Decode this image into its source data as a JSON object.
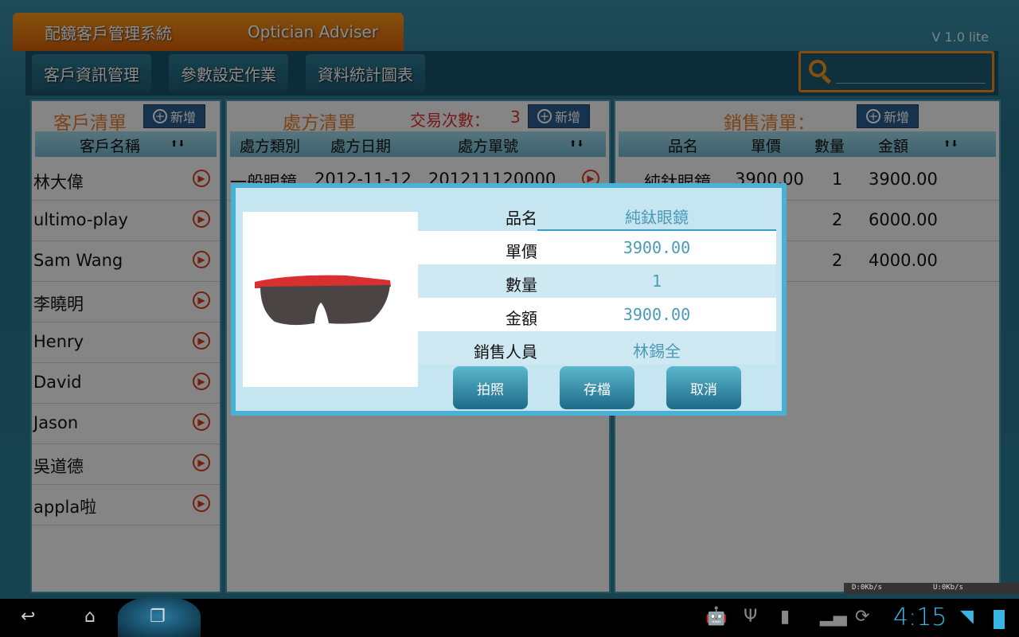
{
  "header": {
    "title_cn": "配鏡客戶管理系統",
    "title_en": "Optician Adviser",
    "version": "V 1.0 lite",
    "search_value": ""
  },
  "nav": [
    "客戶資訊管理",
    "參數設定作業",
    "資料統計圖表"
  ],
  "customers": {
    "title": "客戶清單",
    "add": "新增",
    "col": "客戶名稱",
    "sort": "⬆⬇",
    "rows": [
      "林大偉",
      "ultimo-play",
      "Sam Wang",
      "李曉明",
      "Henry",
      "David",
      "Jason",
      "吳道德",
      "appla啦"
    ]
  },
  "prescriptions": {
    "title": "處方清單",
    "count_label": "交易次數：",
    "count": "3",
    "add": "新增",
    "cols": [
      "處方類別",
      "處方日期",
      "處方單號"
    ],
    "sort": "⬆⬇",
    "rows": [
      {
        "type": "一般眼鏡",
        "date": "2012-11-12",
        "no": "201211120000"
      }
    ]
  },
  "sales": {
    "title": "銷售清單：",
    "add": "新增",
    "cols": [
      "品名",
      "單價",
      "數量",
      "金額"
    ],
    "sort": "⬆⬇",
    "rows": [
      {
        "name": "純鈦眼鏡",
        "price": "3900.00",
        "qty": "1",
        "amount": "3900.00"
      },
      {
        "name": "",
        "price": "00",
        "qty": "2",
        "amount": "6000.00"
      },
      {
        "name": "",
        "price": "00",
        "qty": "2",
        "amount": "4000.00"
      }
    ]
  },
  "dialog": {
    "fields": [
      {
        "label": "品名",
        "value": "純鈦眼鏡"
      },
      {
        "label": "單價",
        "value": "3900.00"
      },
      {
        "label": "數量",
        "value": "1"
      },
      {
        "label": "金額",
        "value": "3900.00"
      },
      {
        "label": "銷售人員",
        "value": "林錫全"
      }
    ],
    "buttons": [
      "拍照",
      "存檔",
      "取消"
    ]
  },
  "status": {
    "down": "D:0Kb/s",
    "up": "U:0Kb/s",
    "time": "4:15"
  }
}
